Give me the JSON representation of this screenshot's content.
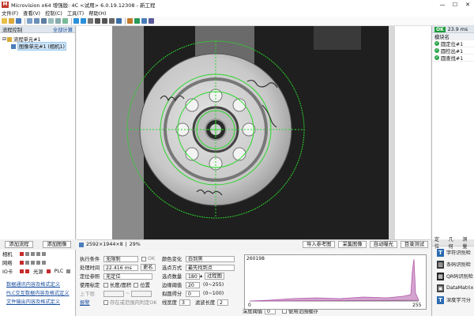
{
  "window": {
    "title": "Microvision x64 增强版: 4C <试用> 6.0.19.12308 - 新工程",
    "minimize": "—",
    "maximize": "☐",
    "close": "✕"
  },
  "menu": [
    "文件(F)",
    "查看(V)",
    "控制(C)",
    "工具(T)",
    "帮助(H)"
  ],
  "left_panel": {
    "title": "流程控制",
    "action": "全部计算",
    "tree_root": "流程单元#1",
    "tree_child": "图像单元#1 (相机1)",
    "add_flow": "添加流程",
    "add_image": "添加图像"
  },
  "status_bar": {
    "image_info": "2592×1944×8",
    "zoom": "29%",
    "buttons": [
      "导入参考图",
      "采集图像",
      "自动曝光",
      "目录测试"
    ]
  },
  "right_panel": {
    "status": "OK",
    "time": "23.9 ms",
    "header": "模块名",
    "modules": [
      "圆定位#1",
      "圆检出#1",
      "圆查找#1"
    ]
  },
  "io": {
    "camera_label": "相机",
    "net_label": "网络",
    "io_label": "IO卡",
    "light_label": "光源",
    "plc_label": "PLC"
  },
  "links": [
    "数据通讯内容及格式定义",
    "PLC交互数据内容及格式定义",
    "文件输出内容及格式定义"
  ],
  "params": {
    "exec_cond_label": "执行条件",
    "exec_cond": "无限制",
    "ok_label": "OK",
    "proc_time_label": "处理时间",
    "proc_time": "22.416 ms",
    "rename": "更名",
    "locate_label": "定位参照",
    "locate": "无定位",
    "calib_label": "使用标定",
    "len_area": "长度/面积",
    "position": "位置",
    "upper_label": "上下限",
    "alarm": "报警",
    "exist_label": "存在或范围内判定OK",
    "color_label": "颜色变化",
    "color": "白到黑",
    "point_mode_label": "选点方式",
    "point_mode": "最先找到点",
    "point_count_label": "选点数量",
    "point_count": "180",
    "thresh_label": "边缘阈值",
    "thresh": "20",
    "thresh_range": "(0~255)",
    "score_label": "拟圆得分",
    "score": "0",
    "score_range": "(0~100)",
    "line_width_label": "线宽度",
    "line_width": "3",
    "filter_label": "滤波长度",
    "filter": "2",
    "depth_label": "深度阈值",
    "depth": "0",
    "cache_label": "使用范围缓存",
    "clear_btn": "过程图"
  },
  "histogram": {
    "max_label": "260198",
    "x_min": "0",
    "x_max": "255"
  },
  "tools": {
    "tabs": [
      "定位",
      "几何",
      "测量"
    ],
    "items": [
      "字符识别检",
      "条码识别检",
      "QR码识别检",
      "DataMatrix",
      "深度学习分"
    ]
  },
  "colors": {
    "ok": "#1e9e3a",
    "accent": "#1a4fa0",
    "hist": "#b05aa8",
    "green": "#2bd62b"
  }
}
